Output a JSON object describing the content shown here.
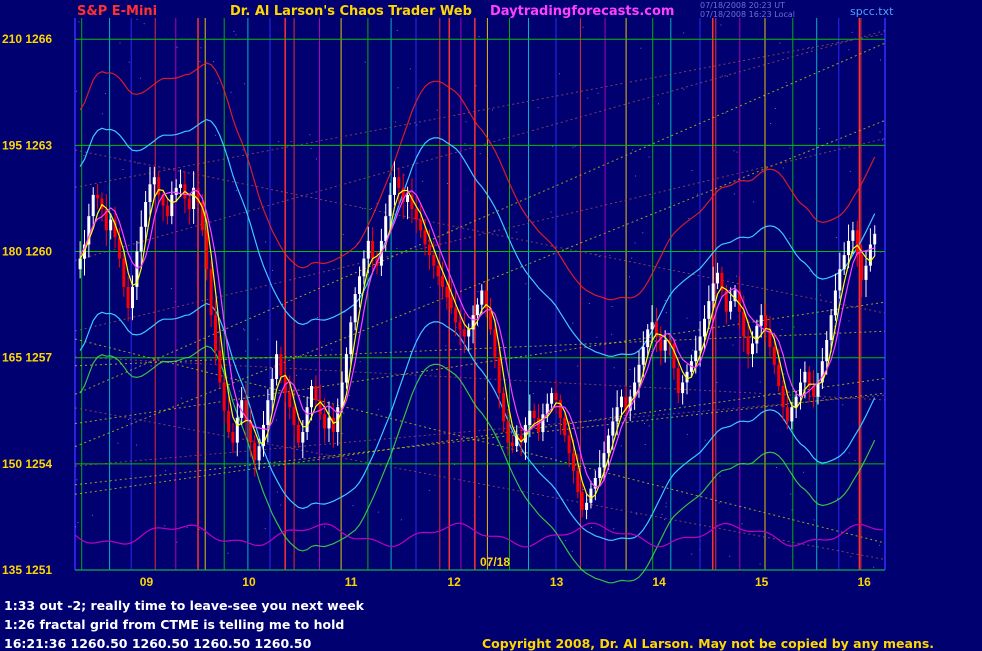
{
  "header": {
    "symbol": "S&P E-Mini",
    "title": "Dr. Al Larson's Chaos Trader Web",
    "site": "Daytradingforecasts.com",
    "stamp1": "07/18/2008 20:23 UT",
    "stamp2": "07/18/2008 16:23 Local",
    "file": "spcc.txt"
  },
  "colors": {
    "background": "#000070",
    "bull_candle": "#ffffff",
    "bear_candle": "#ff0000",
    "symbol": "#ff3030",
    "site": "#ff40ff",
    "axis": "#ffd700"
  },
  "notes": [
    "1:33 out -2; really time to leave-see you next week",
    "1:26 fractal grid from CTME is telling me to hold",
    "16:21:36  1260.50  1260.50  1260.50  1260.50"
  ],
  "copyright": "Copyright 2008, Dr. Al Larson. May not be copied by any means.",
  "chart_data": {
    "type": "candlestick",
    "y_left_ticks": [
      "210 1266",
      "195 1263",
      "180 1260",
      "165 1257",
      "150 1254",
      "135 1251"
    ],
    "y_tick_values": [
      1266,
      1263,
      1260,
      1257,
      1254,
      1251
    ],
    "ylim": [
      1251,
      1266.6
    ],
    "x_ticks": [
      "09",
      "10",
      "11",
      "12",
      "13",
      "14",
      "15",
      "16"
    ],
    "x_tick_hours": [
      9,
      10,
      11,
      12,
      13,
      14,
      15,
      16
    ],
    "xlim": [
      8.3,
      16.2
    ],
    "date_label": "07/18",
    "closes": [
      1259.8,
      1260.2,
      1261.0,
      1261.6,
      1261.5,
      1261.2,
      1260.6,
      1260.9,
      1260.4,
      1259.8,
      1259.0,
      1258.4,
      1259.0,
      1260.0,
      1260.7,
      1261.4,
      1261.9,
      1262.1,
      1261.6,
      1261.3,
      1261.0,
      1261.6,
      1261.8,
      1261.9,
      1261.5,
      1261.2,
      1261.8,
      1261.4,
      1260.6,
      1259.5,
      1258.2,
      1257.2,
      1256.3,
      1255.5,
      1254.9,
      1254.6,
      1255.3,
      1255.8,
      1255.2,
      1254.6,
      1254.1,
      1254.5,
      1255.1,
      1255.8,
      1256.4,
      1257.1,
      1256.5,
      1256.0,
      1255.6,
      1255.1,
      1254.6,
      1254.9,
      1255.6,
      1256.2,
      1255.8,
      1255.4,
      1255.0,
      1255.3,
      1254.9,
      1255.6,
      1256.3,
      1257.1,
      1258.0,
      1258.8,
      1259.3,
      1259.8,
      1260.3,
      1259.8,
      1259.6,
      1260.3,
      1261.0,
      1261.6,
      1262.1,
      1261.8,
      1261.4,
      1261.6,
      1261.2,
      1260.9,
      1260.6,
      1260.2,
      1259.9,
      1259.6,
      1259.3,
      1259.0,
      1258.7,
      1258.4,
      1258.0,
      1257.8,
      1257.6,
      1257.8,
      1258.2,
      1258.5,
      1258.9,
      1258.4,
      1257.8,
      1257.0,
      1256.0,
      1255.2,
      1254.6,
      1254.5,
      1254.8,
      1254.6,
      1255.1,
      1255.5,
      1255.3,
      1254.9,
      1255.4,
      1255.7,
      1256.0,
      1255.8,
      1255.3,
      1254.8,
      1254.3,
      1253.8,
      1253.2,
      1252.7,
      1252.9,
      1253.3,
      1253.6,
      1253.9,
      1254.3,
      1254.8,
      1255.2,
      1255.6,
      1255.9,
      1255.5,
      1255.9,
      1256.3,
      1256.8,
      1257.3,
      1257.8,
      1258.0,
      1257.6,
      1257.2,
      1257.5,
      1257.4,
      1256.7,
      1256.0,
      1256.3,
      1256.6,
      1256.9,
      1257.2,
      1257.6,
      1258.1,
      1258.6,
      1259.1,
      1259.4,
      1258.9,
      1258.3,
      1258.6,
      1258.9,
      1258.3,
      1257.6,
      1257.1,
      1257.4,
      1257.9,
      1258.2,
      1257.8,
      1257.3,
      1256.8,
      1256.2,
      1255.6,
      1255.2,
      1255.6,
      1255.9,
      1256.3,
      1256.6,
      1256.2,
      1255.9,
      1256.3,
      1256.9,
      1257.5,
      1258.2,
      1258.9,
      1259.5,
      1259.9,
      1260.3,
      1260.6,
      1259.9,
      1259.2,
      1259.6,
      1260.2,
      1260.5
    ]
  }
}
